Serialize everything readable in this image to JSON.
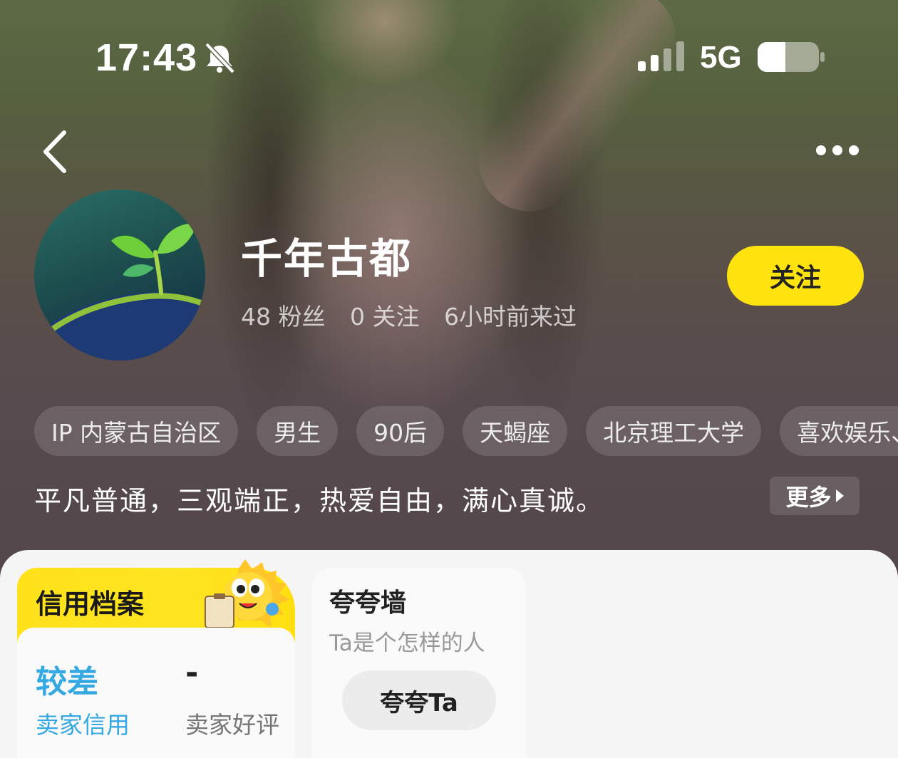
{
  "status_bar": {
    "time": "17:43",
    "network": "5G",
    "icons": [
      "bell-muted-icon",
      "signal-icon",
      "battery-icon"
    ]
  },
  "nav": {
    "icons": [
      "back-icon",
      "more-icon"
    ]
  },
  "profile": {
    "name": "千年古都",
    "stats": {
      "fans": "48 粉丝",
      "following": "0 关注",
      "last_seen": "6小时前来过"
    },
    "follow_label": "关注",
    "tags": [
      "IP 内蒙古自治区",
      "男生",
      "90后",
      "天蝎座",
      "北京理工大学",
      "喜欢娱乐、"
    ],
    "bio": "平凡普通，三观端正，热爱自由，满心真诚。",
    "more_label": "更多"
  },
  "credit": {
    "title": "信用档案",
    "seller_credit_value": "较差",
    "seller_credit_label": "卖家信用",
    "seller_rating_value": "-",
    "seller_rating_label": "卖家好评"
  },
  "praise": {
    "title": "夸夸墙",
    "subtitle": "Ta是个怎样的人",
    "button_label": "夸夸Ta"
  },
  "colors": {
    "accent_yellow": "#ffe30f",
    "credit_blue": "#34a8e3",
    "sheet_bg": "#f5f5f5"
  }
}
